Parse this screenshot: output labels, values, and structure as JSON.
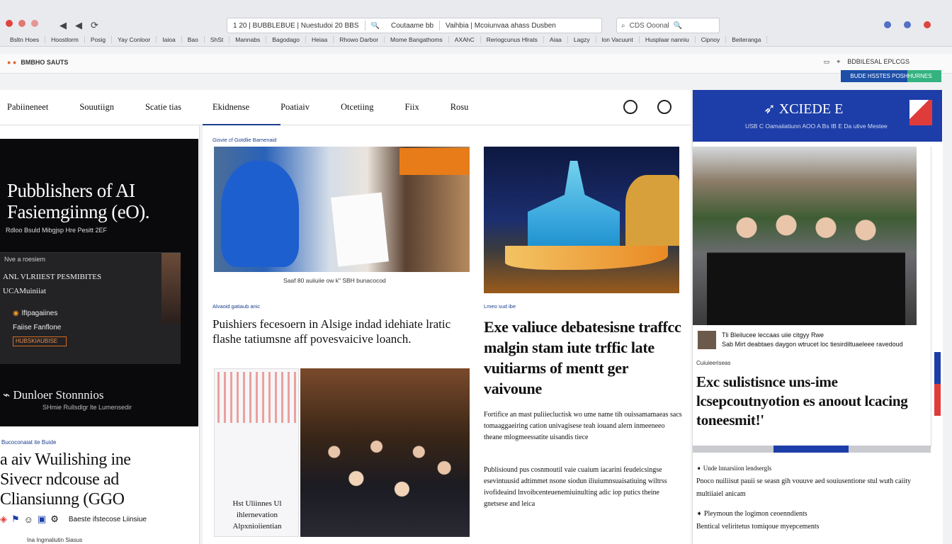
{
  "browser": {
    "controls": [
      "◀",
      "◀"
    ],
    "omnibox_segments": [
      "1 20 | BUBBLEBUE | Nuestudoi 20 BBS",
      "Coutaame  bb",
      "Vaihbia | Mcoiunvaa ahass Dusben"
    ],
    "search_placeholder": "CDS Ooonal",
    "bookmarks": [
      "Bsltn Hoes",
      "Hoostlorm",
      "Posig",
      "Yay Conloor",
      "Iaioa",
      "Bao",
      "ShSt",
      "Mannabs",
      "Bagodago",
      "Heiaa",
      "Rhowo Darbor",
      "Mome Bangathoms",
      "AXAhC",
      "Reriogcunus Hlrats",
      "Aiaa",
      "Lagzy",
      "lon Vacuunt",
      "Husplaar nanniu",
      "Cipnoy",
      "Beiteranga"
    ]
  },
  "subbar": {
    "brand": "BMBHO SAUTS",
    "right_text": "BDBILESAL EPLCGS",
    "cta_label": "BUDE HSSTES POSHHURNES"
  },
  "site_nav": {
    "items": [
      "Pabiineneet",
      "Souutiign",
      "Scatie tias",
      "Ekidnense",
      "Poatiaiv",
      "Otcetiing",
      "Fiix",
      "Rosu"
    ]
  },
  "left": {
    "hero_title_1": "Pubblishers of AI",
    "hero_title_2": "Fasiemgiinng (eO).",
    "hero_sub": "Rdloo Bsuld Mibgjsp Hre Pesitt 2EF",
    "ad_kicker": "Nve a roesiem",
    "ad_line_1": "ANL VLRIIEST PESMIBITES",
    "ad_line_2": "UCAMuiniiat",
    "ad_opt_1": "lfIpagaiines",
    "ad_opt_2": "Faiise Fanflone",
    "ad_button": "HUBSKIAUBISE",
    "logo_line": "Dunloer Stonnnios",
    "logo_sub": "SHmie Rullsdlgr lte Lumensedir",
    "headline_kicker": "Bucoconaiat ite Buide",
    "headline_1": "a aiv Wuilishing ine",
    "headline_2": "Sivecr ndcouse ad",
    "headline_3": "Cliansiunng (GGO",
    "icon_caption": "Baeste ifstecose Liinsiue",
    "footer": "Ina Ingmaliutin Siasus"
  },
  "main": {
    "kicker_1": "Gisvie cf Gotdlie Bamenaid",
    "caption_1": "Saaf 80 auiiuiie ow k\" SBH bunacocod",
    "kicker_2": "Alvaoid gatiaub anic",
    "headline_2": "Puishiers fecesoern in Alsige indad idehiate lratic flashe tatiumsne aff povesvaicive loanch.",
    "kicker_3": "Lmeo sud ibe",
    "headline_3": "Exe valiuce debatesisne traffcc malgin stam iute trffic late vuitiarms of mentt ger vaivoune",
    "para_3": "Fortifice an mast puliiecluctisk wo ume name tih ouissamamaeas sacs tomaaggaeiring cation univagisese teah iouand alern inmeeneeo theane mlogmeessatite uisandis tiece",
    "para_4": "Publisiound pus cosnmoutil vaie cuaium iacarini feudeicsingse esevintuusid adtimmet nsone siodun iliuiumnsuaisatiuing wiltrss ivofideaind lnvoibcenteuenemiuinulting adic iop putics theine gnetsese and leica",
    "photo_caption": "Hst Uliinnes Ul ihlernevation Alpxnioiientian"
  },
  "right": {
    "banner_logo": "XCIEDE E",
    "banner_tag": "USB C Oamaiiatiunn AOO A Bs IB E Da utive Mestee",
    "byline_1": "Tli Bleilucee leccaas uiie citgyy Rwe",
    "byline_2": "Sab Mirt deabtaes daygon wtrucet loc tiesirdiltuaeleee ravedoud",
    "kicker": "Cuiuieeriseas",
    "headline": "Exc sulistisnce uns-ime lcsepcoutnyotion es anoout lcacing toneesmit!'",
    "list": [
      {
        "head": "Unde lnnarsiion lendsergls",
        "body": "Pnoco nuiliisut pauii se seasn gih vouuve aed souiusentione stul wuth caiity multiiaiel anicam"
      },
      {
        "head": "Pleymoun the logimon ceoenndients",
        "body": "Bentical veliritetus tomiqoue myepcements"
      }
    ]
  },
  "colors": {
    "accent": "#1d3f8f",
    "banner": "#1d3ea8",
    "cta_green": "#38c47a",
    "dark_hero": "#0a0a0d"
  }
}
